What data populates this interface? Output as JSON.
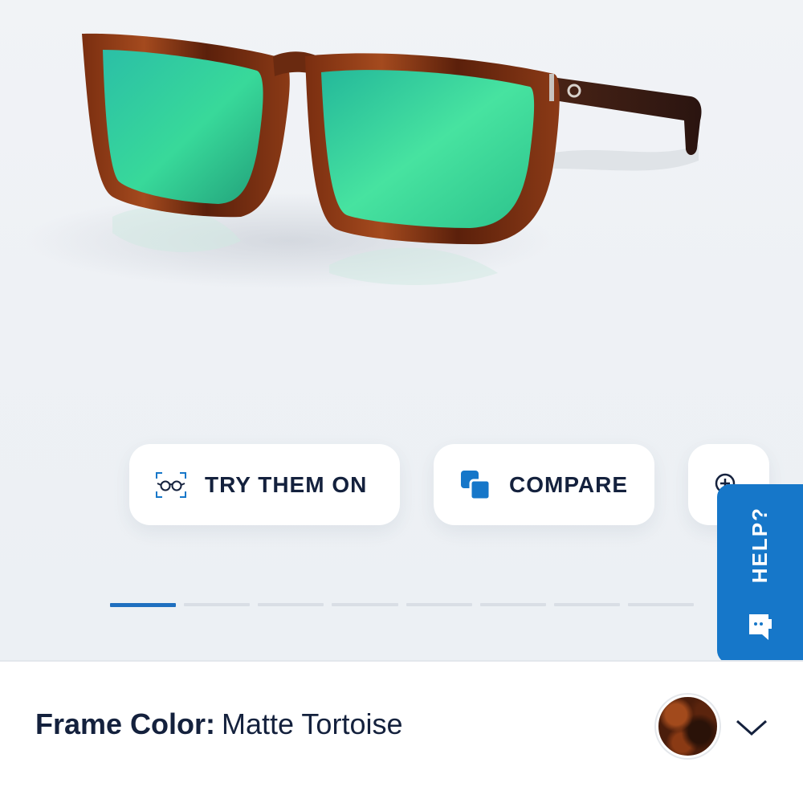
{
  "product": {
    "image_alt": "sunglasses-product-image",
    "frame_color_label": "Frame Color:",
    "frame_color_value": "Matte Tortoise"
  },
  "actions": {
    "try_on_label": "TRY THEM ON",
    "compare_label": "COMPARE"
  },
  "carousel": {
    "total_slides": 8,
    "active_index": 0
  },
  "help": {
    "label": "HELP?"
  },
  "colors": {
    "accent": "#1677c9",
    "text_dark": "#14213d",
    "lens_green": "#2ed692",
    "frame_tortoise": "#6b2a10"
  },
  "icons": {
    "try_on": "glasses-scan-icon",
    "compare": "compare-squares-icon",
    "zoom": "zoom-in-icon",
    "help": "chat-icon",
    "dropdown": "chevron-down-icon"
  }
}
